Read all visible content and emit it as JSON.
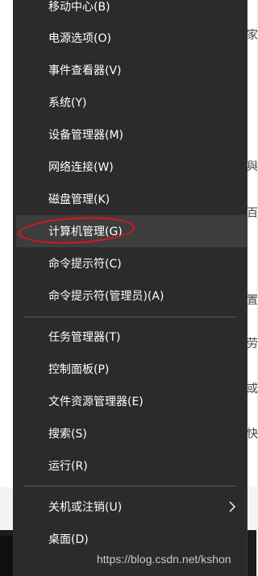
{
  "background": {
    "chars": [
      "家",
      "與",
      "百",
      "置",
      "劳",
      "或",
      "快"
    ]
  },
  "menu": {
    "group1": [
      {
        "label": "移动中心(B)"
      },
      {
        "label": "电源选项(O)"
      },
      {
        "label": "事件查看器(V)"
      },
      {
        "label": "系统(Y)"
      },
      {
        "label": "设备管理器(M)"
      },
      {
        "label": "网络连接(W)"
      },
      {
        "label": "磁盘管理(K)"
      },
      {
        "label": "计算机管理(G)"
      },
      {
        "label": "命令提示符(C)"
      },
      {
        "label": "命令提示符(管理员)(A)"
      }
    ],
    "group2": [
      {
        "label": "任务管理器(T)"
      },
      {
        "label": "控制面板(P)"
      },
      {
        "label": "文件资源管理器(E)"
      },
      {
        "label": "搜索(S)"
      },
      {
        "label": "运行(R)"
      }
    ],
    "group3": [
      {
        "label": "关机或注销(U)"
      },
      {
        "label": "桌面(D)"
      }
    ],
    "hovered_item": "计算机管理(G)",
    "annotation_color": "#e0141e"
  },
  "watermark": "https://blog.csdn.net/kshon"
}
